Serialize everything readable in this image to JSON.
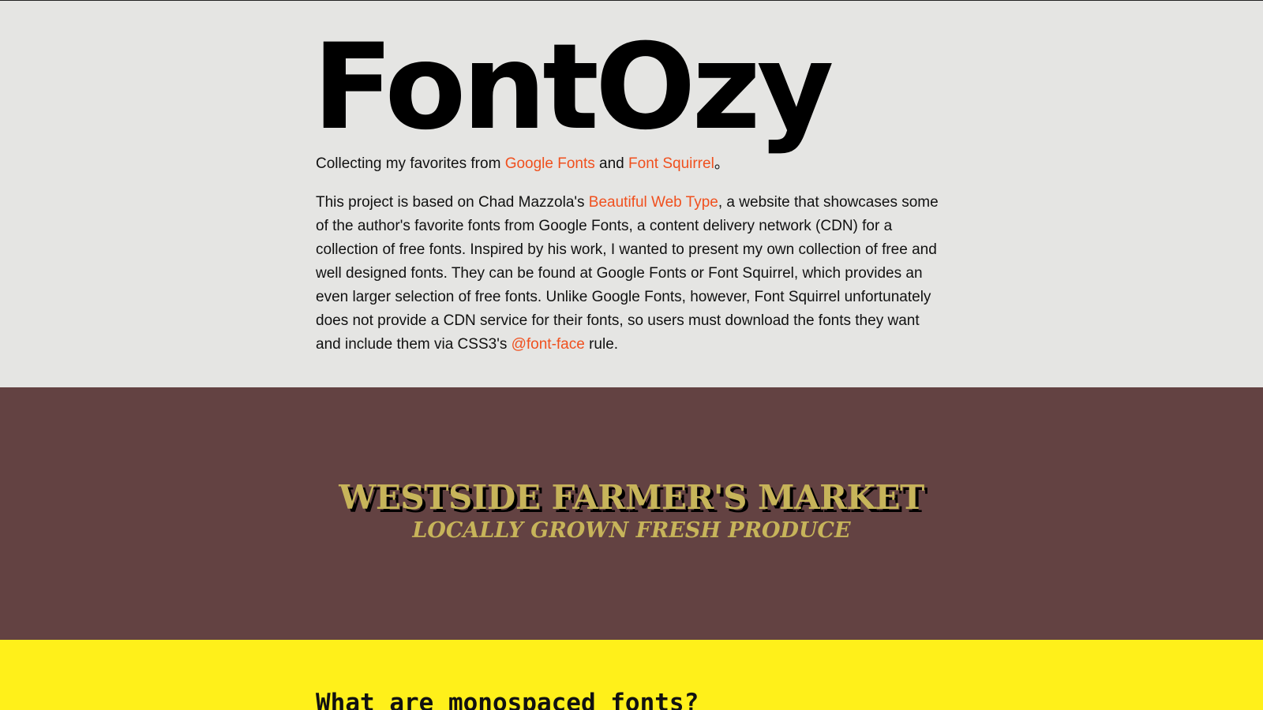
{
  "hero": {
    "title": "FontOzy",
    "tagline": {
      "prefix": "Collecting my favorites from ",
      "link1": "Google Fonts",
      "middle": " and ",
      "link2": "Font Squirrel",
      "suffix": "。"
    },
    "intro": {
      "part1": "This project is based on Chad Mazzola's ",
      "link1": "Beautiful Web Type",
      "part2": ", a website that showcases some of the author's favorite fonts from Google Fonts, a content delivery network (CDN) for a collection of free fonts. Inspired by his work, I wanted to present my own collection of free and well designed fonts. They can be found at Google Fonts or Font Squirrel, which provides an even larger selection of free fonts. Unlike Google Fonts, however, Font Squirrel unfortunately does not provide a CDN service for their fonts, so users must download the fonts they want and include them via CSS3's ",
      "link2": "@font-face",
      "part3": " rule."
    }
  },
  "market": {
    "title": "WESTSIDE FARMER'S MARKET",
    "subtitle": "LOCALLY GROWN FRESH PRODUCE"
  },
  "mono": {
    "heading": "What are monospaced fonts?"
  },
  "colors": {
    "hero_bg": "#e5e5e3",
    "link": "#f0501e",
    "market_bg": "#634242",
    "market_text": "#c7b45a",
    "mono_bg": "#fff01a"
  }
}
